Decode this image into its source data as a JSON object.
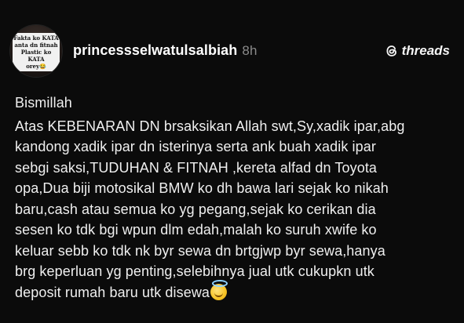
{
  "post": {
    "avatar_caption": [
      "Fakta ko KATA",
      "anta dn fitnah",
      "Plastic ko KATA",
      "orey😂"
    ],
    "username": "princessselwatulsalbiah",
    "time": "8h",
    "brand": "threads",
    "greeting": "Bismillah",
    "lines": [
      "Atas KEBENARAN DN brsaksikan Allah swt,Sy,xadik ipar,abg",
      "kandong xadik ipar dn isterinya serta ank buah xadik ipar",
      "sebgi saksi,TUDUHAN & FITNAH ,kereta alfad dn Toyota",
      "opa,Dua biji motosikal BMW ko dh bawa lari sejak ko nikah",
      "baru,cash atau semua ko yg pegang,sejak ko cerikan dia",
      "sesen ko tdk bgi wpun dlm edah,malah ko suruh xwife ko",
      "keluar sebb ko tdk nk byr sewa dn brtgjwp byr sewa,hanya",
      "brg keperluan yg penting,selebihnya jual utk cukupkn utk",
      "deposit rumah baru utk disewa"
    ]
  }
}
